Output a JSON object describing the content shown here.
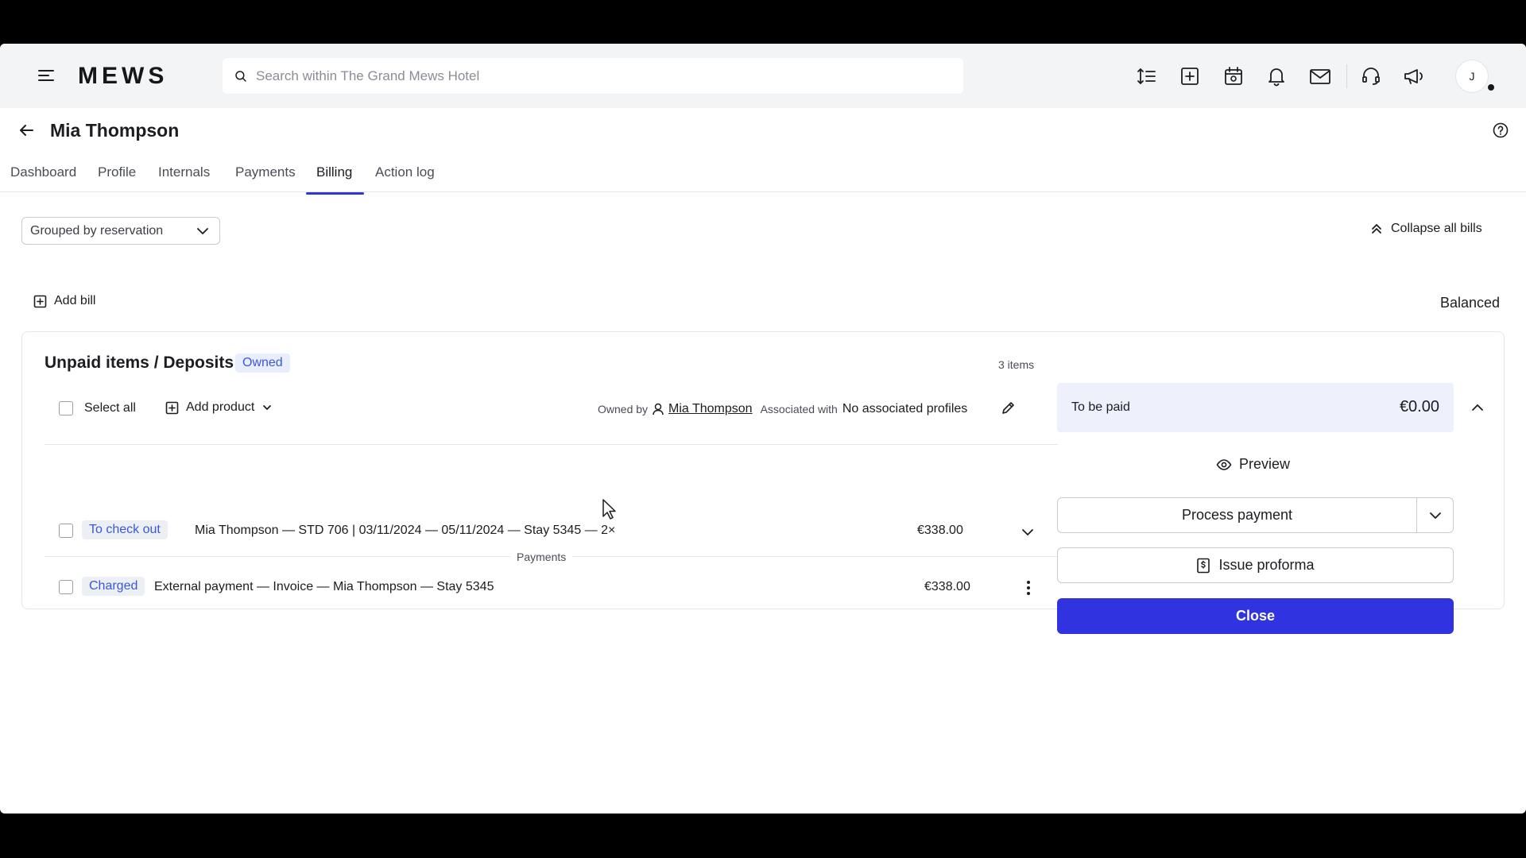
{
  "app": {
    "logo": "MEWS"
  },
  "search": {
    "placeholder": "Search within The Grand Mews Hotel"
  },
  "user": {
    "initial": "J"
  },
  "profile": {
    "name": "Mia Thompson"
  },
  "tabs": [
    {
      "label": "Dashboard"
    },
    {
      "label": "Profile"
    },
    {
      "label": "Internals"
    },
    {
      "label": "Payments"
    },
    {
      "label": "Billing"
    },
    {
      "label": "Action log"
    }
  ],
  "controls": {
    "grouping": "Grouped by reservation",
    "collapse_label": "Collapse all bills",
    "add_bill_label": "Add bill",
    "balance_status": "Balanced"
  },
  "bill": {
    "title": "Unpaid items / Deposits",
    "badge": "Owned",
    "items_count": "3 items",
    "select_all": "Select all",
    "add_product": "Add product",
    "owned_by_label": "Owned by",
    "owner": "Mia Thompson",
    "associated_label": "Associated with",
    "associated_value": "No associated profiles",
    "payments_separator": "Payments",
    "rows": [
      {
        "badge": "To check out",
        "text": "Mia Thompson — STD 706 | 03/11/2024 — 05/11/2024 — Stay 5345 — 2×",
        "amount": "€338.00"
      },
      {
        "badge": "Charged",
        "text": "External payment — Invoice — Mia Thompson — Stay 5345",
        "amount": "€338.00"
      }
    ]
  },
  "summary": {
    "to_be_paid_label": "To be paid",
    "to_be_paid_amount": "€0.00",
    "preview_label": "Preview",
    "process_payment_label": "Process payment",
    "issue_proforma_label": "Issue proforma",
    "close_label": "Close"
  },
  "colors": {
    "accent": "#2f33e0",
    "badge_text": "#3a58d8",
    "badge_bg": "#e9eeff"
  }
}
